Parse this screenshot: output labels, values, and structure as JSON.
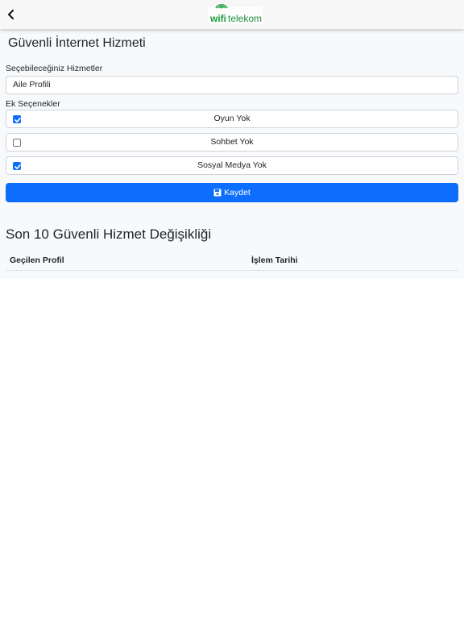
{
  "header": {
    "logo": {
      "wifi": "wifi",
      "telekom": "telekom"
    }
  },
  "page": {
    "title": "Güvenli İnternet Hizmeti"
  },
  "services": {
    "label": "Seçebileceğiniz Hizmetler",
    "selected": "Aile Profili"
  },
  "extras": {
    "label": "Ek Seçenekler",
    "options": [
      {
        "label": "Oyun Yok",
        "checked": true
      },
      {
        "label": "Sohbet Yok",
        "checked": false
      },
      {
        "label": "Sosyal Medya Yok",
        "checked": true
      }
    ]
  },
  "save": {
    "label": "Kaydet"
  },
  "history": {
    "title": "Son 10 Güvenli Hizmet Değişikliği",
    "columns": [
      "Geçilen Profil",
      "İşlem Tarihi"
    ]
  },
  "colors": {
    "primary": "#0d6efd",
    "brand_green": "#1a9c3a"
  }
}
